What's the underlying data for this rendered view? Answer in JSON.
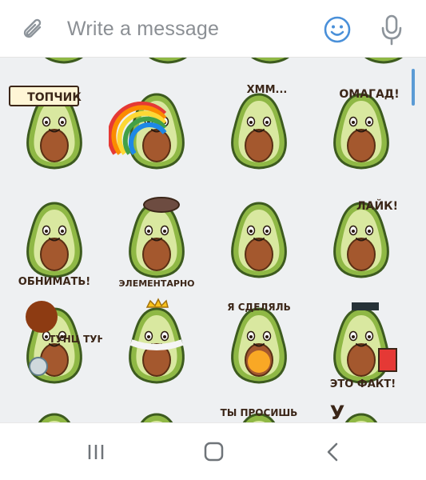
{
  "composer": {
    "placeholder": "Write a message",
    "icons": [
      "paperclip-icon",
      "emoji-icon",
      "microphone-icon"
    ]
  },
  "colors": {
    "panel_bg": "#eef0f2",
    "accent": "#5b9bd5",
    "avocado_skin": "#8fb845",
    "avocado_flesh": "#d9e8a0",
    "pit": "#a4582e",
    "text_dark": "#3b2618"
  },
  "stickers": [
    {
      "caption": "ТОПЧИК"
    },
    {
      "caption": ""
    },
    {
      "caption": "ХММ..."
    },
    {
      "caption": "ОМАГАД!"
    },
    {
      "caption": "ОБНИМАТЬ!"
    },
    {
      "caption": "ЭЛЕМЕНТАРНО"
    },
    {
      "caption": ""
    },
    {
      "caption": "ЛАЙК!"
    },
    {
      "caption": "ТУНЦ ТУНЦ"
    },
    {
      "caption": ""
    },
    {
      "caption": "Я СДЕЛЯЛЬ"
    },
    {
      "caption": "ЭТО ФАКТ!"
    },
    {
      "caption": ""
    },
    {
      "caption": ""
    },
    {
      "caption": "ТЫ ПРОСИШЬ"
    },
    {
      "caption": "У"
    }
  ],
  "navbar": {
    "buttons": [
      "recents-button",
      "home-button",
      "back-button"
    ]
  }
}
